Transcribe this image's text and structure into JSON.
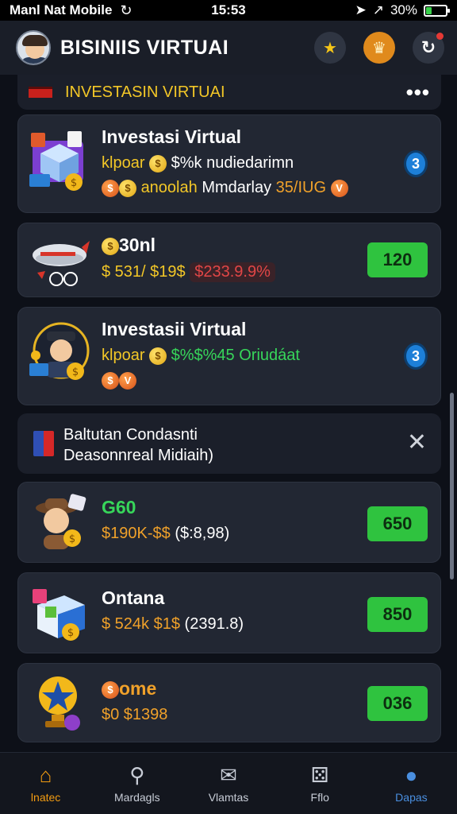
{
  "status_bar": {
    "carrier": "Manl Nat Mobile",
    "time": "15:53",
    "battery": "30%",
    "battery_level": 0.3
  },
  "header": {
    "title": "BISINIIS VIRTUAI"
  },
  "section": {
    "title": "INVESTASIN VIRTUAI",
    "more": "•••"
  },
  "cards": [
    {
      "title": "Investasi Virtual",
      "line1_a": "klpoar",
      "line1_b": "$%k nudiedarimn",
      "line2_a": "anoolah",
      "line2_b": "Mmdarlay",
      "line2_c": "35/IUG",
      "badge": "3"
    },
    {
      "title": "30nl",
      "line1_a": "$ 531/ $19$",
      "line1_b": "$233.9.9%",
      "button": "120"
    },
    {
      "title": "Investasii Virtual",
      "line1_a": "klpoar",
      "line1_b": "$%$%45",
      "line1_c": "Oriudáat",
      "badge": "3"
    }
  ],
  "info_banner": {
    "line1": "Baltutan Condasnti",
    "line2": "Deasonnreal Midiaih)"
  },
  "list_items": [
    {
      "title": "G60",
      "price": "$190K-$$",
      "detail": "($:8,98)",
      "button": "650"
    },
    {
      "title": "Ontana",
      "price": "$ 524k $1$",
      "detail": "(2391.8)",
      "button": "850"
    },
    {
      "title": "ome",
      "price": "$0 $1398",
      "detail": "",
      "button": "036"
    }
  ],
  "tabs": [
    {
      "label": "lnatec",
      "icon": "home-icon"
    },
    {
      "label": "Mardagls",
      "icon": "search-icon"
    },
    {
      "label": "Vlamtas",
      "icon": "mail-icon"
    },
    {
      "label": "Fflo",
      "icon": "dice-icon"
    },
    {
      "label": "Dapas",
      "icon": "profile-icon"
    }
  ],
  "colors": {
    "accent_yellow": "#f3c727",
    "accent_green": "#2fc33f",
    "accent_orange": "#f39c12",
    "background": "#0d1018",
    "card": "#222733"
  }
}
